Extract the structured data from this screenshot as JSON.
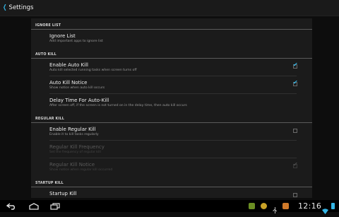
{
  "actionbar": {
    "title": "Settings"
  },
  "sections": [
    {
      "header": "IGNORE LIST",
      "items": [
        {
          "title": "Ignore List",
          "summary": "Add important apps to ignore list",
          "checkbox": null,
          "enabled": true
        }
      ]
    },
    {
      "header": "AUTO KILL",
      "items": [
        {
          "title": "Enable Auto Kill",
          "summary": "Auto kill selected running tasks when screen turns off",
          "checkbox": "checked",
          "enabled": true
        },
        {
          "title": "Auto Kill Notice",
          "summary": "Show notice when auto kill occurs",
          "checkbox": "checked",
          "enabled": true
        },
        {
          "title": "Delay Time For Auto-Kill",
          "summary": "After screen off, if the screen is not turned on in the delay time, then auto kill occurs",
          "checkbox": null,
          "enabled": true
        }
      ]
    },
    {
      "header": "REGULAR KILL",
      "items": [
        {
          "title": "Enable Regular Kill",
          "summary": "Enable it to kill tasks regularly",
          "checkbox": "unchecked",
          "enabled": true
        },
        {
          "title": "Regular Kill Frequency",
          "summary": "Set the frequency of regular kill",
          "checkbox": null,
          "enabled": false
        },
        {
          "title": "Regular Kill Notice",
          "summary": "Show notice when regular kill occurred",
          "checkbox": "checked",
          "enabled": false
        }
      ]
    },
    {
      "header": "STARTUP KILL",
      "items": [
        {
          "title": "Startup Kill",
          "summary": "",
          "checkbox": "unchecked",
          "enabled": true
        }
      ]
    }
  ],
  "statusbar": {
    "time": "12:16"
  },
  "colors": {
    "accent": "#33b5e5",
    "background": "#0d0d0d",
    "panel": "#1b1b1b"
  },
  "icons": {
    "nav": [
      "back-icon",
      "home-icon",
      "recent-apps-icon"
    ],
    "status": [
      "android-debug-icon",
      "notification-app-icon",
      "usb-icon",
      "sd-card-icon",
      "wifi-icon",
      "battery-icon"
    ]
  }
}
